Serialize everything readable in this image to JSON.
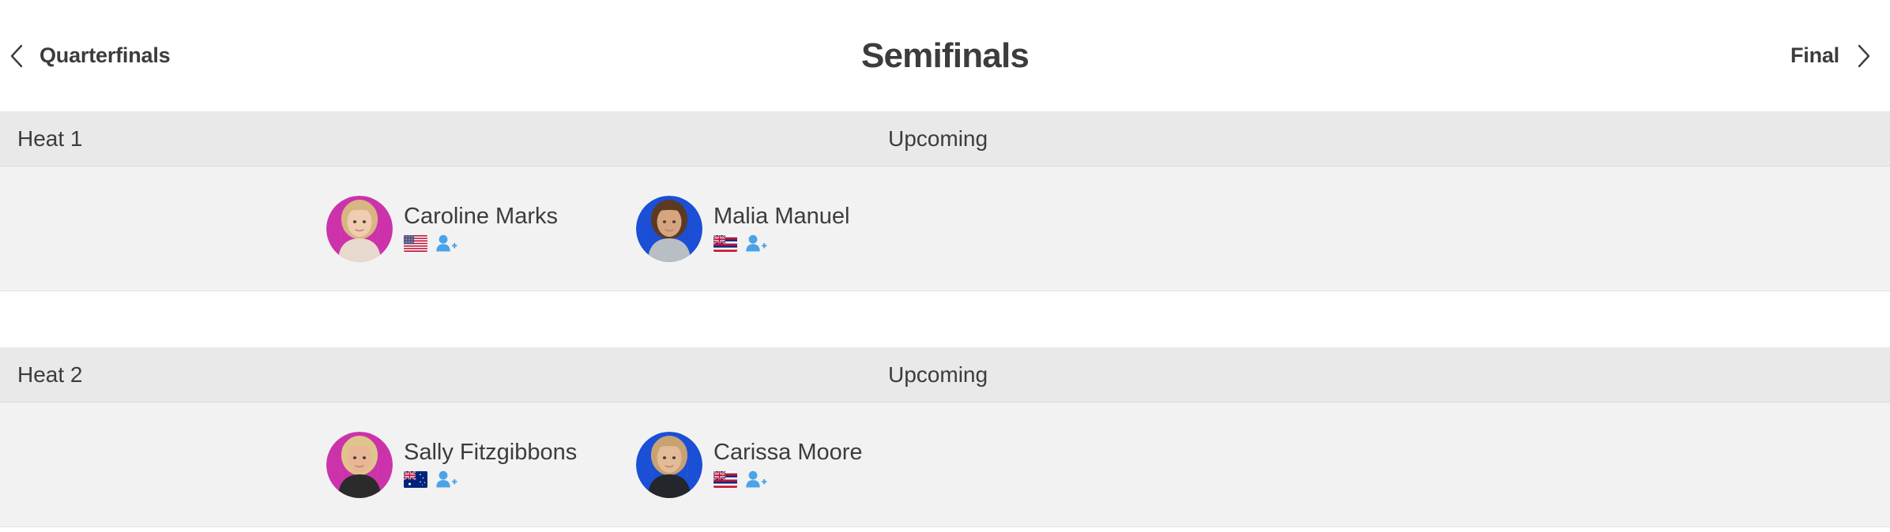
{
  "nav": {
    "prev_label": "Quarterfinals",
    "prev_icon": "chevron-left-icon",
    "title": "Semifinals",
    "next_label": "Final",
    "next_icon": "chevron-right-icon"
  },
  "colors": {
    "text": "#3c3c3c",
    "header_band": "#e9e9e9",
    "row_band": "#f2f2f2",
    "page": "#ffffff",
    "avatar_pink": "#cc33aa",
    "avatar_blue": "#1a4fd6",
    "follow_icon": "#4aa3e8"
  },
  "heats": [
    {
      "name": "Heat 1",
      "status": "Upcoming",
      "athletes": [
        {
          "name": "Caroline Marks",
          "flag": "us-flag-icon",
          "flag_label": "United States",
          "avatar_bg": "#cc33aa",
          "hair": "#d9b583",
          "skin": "#f0cdb0",
          "top": "#e8d9cf",
          "follow_icon": "add-person-icon"
        },
        {
          "name": "Malia Manuel",
          "flag": "hawaii-flag-icon",
          "flag_label": "Hawaii",
          "avatar_bg": "#1a4fd6",
          "hair": "#5c3a22",
          "skin": "#d6a580",
          "top": "#b9bec4",
          "follow_icon": "add-person-icon"
        }
      ]
    },
    {
      "name": "Heat 2",
      "status": "Upcoming",
      "athletes": [
        {
          "name": "Sally Fitzgibbons",
          "flag": "au-flag-icon",
          "flag_label": "Australia",
          "avatar_bg": "#cc33aa",
          "hair": "#e0c48d",
          "skin": "#e8b796",
          "top": "#2b2b2b",
          "follow_icon": "add-person-icon"
        },
        {
          "name": "Carissa Moore",
          "flag": "hawaii-flag-icon",
          "flag_label": "Hawaii",
          "avatar_bg": "#1a4fd6",
          "hair": "#c8a272",
          "skin": "#e3bb97",
          "top": "#23262b",
          "follow_icon": "add-person-icon"
        }
      ]
    }
  ]
}
